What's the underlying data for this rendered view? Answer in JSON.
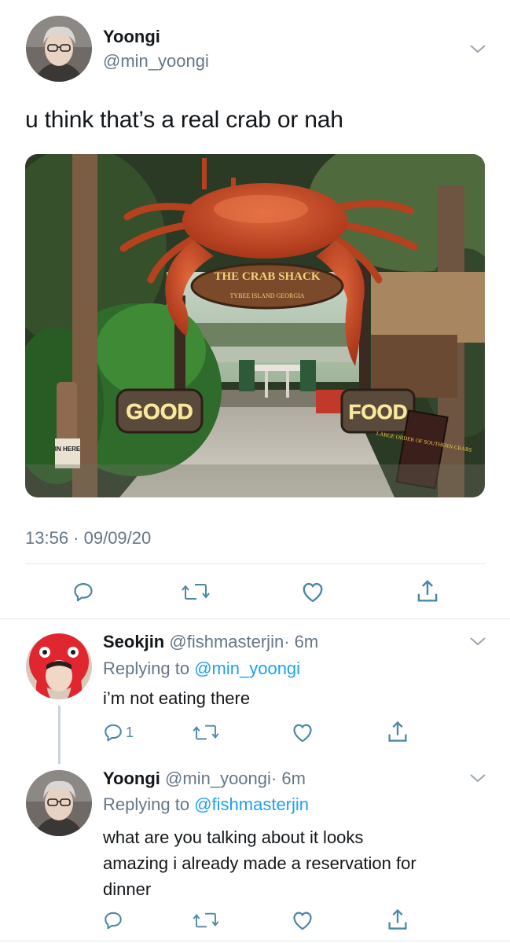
{
  "main_tweet": {
    "name": "Yoongi",
    "handle": "@min_yoongi",
    "text": "u think that’s a real crab or nah",
    "timestamp": "13:56 · 09/09/20",
    "photo": {
      "sign_top": "THE CRAB SHACK",
      "sign_sub": "TYBEE ISLAND GEORGIA",
      "sign_left": "GOOD",
      "sign_right": "FOOD",
      "small_sign": "IN HERE",
      "menu_sign": "LARGE ORDER OF SOUTHERN CRABS"
    },
    "actions": [
      "reply-icon",
      "retweet-icon",
      "like-icon",
      "share-icon"
    ]
  },
  "replies": [
    {
      "name": "Seokjin",
      "handle": "@fishmasterjin",
      "time": "· 6m",
      "replying_prefix": "Replying to",
      "replying_to": "@min_yoongi",
      "text": "i’m not eating there",
      "reply_count": "1"
    },
    {
      "name": "Yoongi",
      "handle": "@min_yoongi",
      "time": "· 6m",
      "replying_prefix": "Replying to",
      "replying_to": "@fishmasterjin",
      "text_lines": [
        "what are you talking about it looks",
        "amazing i already made a reservation for",
        "dinner"
      ],
      "reply_count": ""
    }
  ],
  "colors": {
    "accent": "#1da1f2",
    "muted": "#657786",
    "divider": "#e1e8ed"
  }
}
